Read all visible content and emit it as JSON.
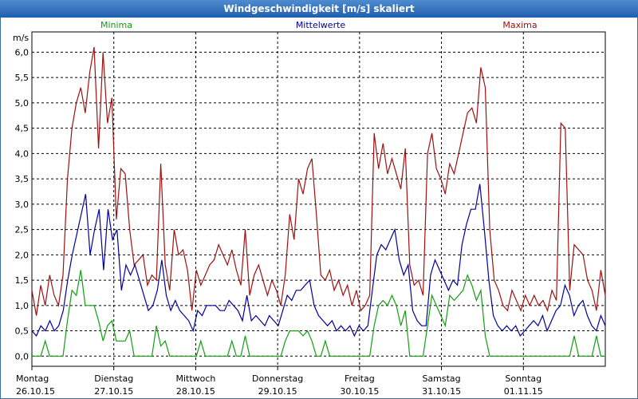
{
  "window": {
    "title": "Windgeschwindigkeit [m/s] skaliert"
  },
  "chart_data": {
    "type": "line",
    "title": "Windgeschwindigkeit [m/s] skaliert",
    "ylabel": "m/s",
    "ylim": [
      -0.2,
      6.4
    ],
    "y_ticks": [
      "0,0",
      "0,5",
      "1,0",
      "1,5",
      "2,0",
      "2,5",
      "3,0",
      "3,5",
      "4,0",
      "4,5",
      "5,0",
      "5,5",
      "6,0"
    ],
    "x_ticks": [
      {
        "day": "Montag",
        "date": "26.10.15"
      },
      {
        "day": "Dienstag",
        "date": "27.10.15"
      },
      {
        "day": "Mittwoch",
        "date": "28.10.15"
      },
      {
        "day": "Donnerstag",
        "date": "29.10.15"
      },
      {
        "day": "Freitag",
        "date": "30.10.15"
      },
      {
        "day": "Samstag",
        "date": "31.10.15"
      },
      {
        "day": "Sonntag",
        "date": "01.11.15"
      }
    ],
    "grid": true,
    "legend_position": "top",
    "series": [
      {
        "name": "Maxima",
        "color": "#a01010",
        "values": [
          1.3,
          0.8,
          1.4,
          1.0,
          1.6,
          1.2,
          1.0,
          1.6,
          3.5,
          4.5,
          5.0,
          5.3,
          4.8,
          5.6,
          6.1,
          4.1,
          6.0,
          4.6,
          5.1,
          2.7,
          3.7,
          3.6,
          2.5,
          1.8,
          1.9,
          2.0,
          1.4,
          1.6,
          1.5,
          3.8,
          1.8,
          1.3,
          2.5,
          2.0,
          2.1,
          1.7,
          0.9,
          1.7,
          1.4,
          1.6,
          1.8,
          1.9,
          2.2,
          2.0,
          1.8,
          2.1,
          1.7,
          1.4,
          2.5,
          1.2,
          1.6,
          1.8,
          1.5,
          1.2,
          1.5,
          1.3,
          1.0,
          1.6,
          2.8,
          2.3,
          3.5,
          3.2,
          3.7,
          3.9,
          2.8,
          1.6,
          1.5,
          1.7,
          1.3,
          1.5,
          1.2,
          1.4,
          1.0,
          1.3,
          0.9,
          1.0,
          1.2,
          4.4,
          3.7,
          4.2,
          3.6,
          3.9,
          3.6,
          3.3,
          4.1,
          1.8,
          1.4,
          1.5,
          1.2,
          4.0,
          4.4,
          3.7,
          3.5,
          3.2,
          3.8,
          3.6,
          4.0,
          4.4,
          4.8,
          4.9,
          4.6,
          5.7,
          5.3,
          2.5,
          1.5,
          1.3,
          1.0,
          0.9,
          1.3,
          1.1,
          0.9,
          1.2,
          1.0,
          1.2,
          1.0,
          1.1,
          0.9,
          1.3,
          1.1,
          4.6,
          4.5,
          1.3,
          2.2,
          2.1,
          2.0,
          1.5,
          1.3,
          0.9,
          1.7,
          1.2
        ]
      },
      {
        "name": "Mittelwerte",
        "color": "#0000a0",
        "values": [
          0.5,
          0.4,
          0.6,
          0.5,
          0.7,
          0.5,
          0.6,
          0.9,
          1.5,
          2.0,
          2.4,
          2.8,
          3.2,
          2.0,
          2.5,
          2.9,
          1.7,
          2.9,
          2.3,
          2.5,
          1.3,
          1.8,
          1.6,
          1.8,
          1.5,
          1.2,
          0.9,
          1.0,
          1.3,
          1.9,
          1.2,
          0.9,
          1.1,
          0.9,
          0.8,
          0.7,
          0.5,
          0.9,
          0.8,
          1.0,
          1.0,
          1.0,
          0.9,
          0.9,
          1.1,
          1.0,
          0.9,
          0.7,
          1.2,
          0.7,
          0.8,
          0.7,
          0.6,
          0.8,
          0.7,
          0.6,
          0.9,
          1.2,
          1.1,
          1.3,
          1.3,
          1.4,
          1.5,
          1.0,
          0.8,
          0.7,
          0.6,
          0.7,
          0.5,
          0.6,
          0.5,
          0.6,
          0.4,
          0.6,
          0.5,
          0.6,
          1.3,
          2.0,
          2.2,
          2.1,
          2.3,
          2.5,
          1.9,
          1.6,
          1.8,
          0.9,
          0.7,
          0.6,
          0.6,
          1.6,
          1.9,
          1.7,
          1.5,
          1.3,
          1.5,
          1.4,
          2.2,
          2.6,
          2.9,
          2.9,
          3.4,
          2.5,
          1.5,
          0.8,
          0.6,
          0.5,
          0.6,
          0.5,
          0.6,
          0.4,
          0.5,
          0.6,
          0.7,
          0.6,
          0.8,
          0.5,
          0.7,
          0.9,
          1.0,
          1.4,
          1.2,
          0.8,
          1.0,
          1.1,
          0.8,
          0.6,
          0.5,
          0.8,
          0.6
        ]
      },
      {
        "name": "Minima",
        "color": "#10a010",
        "values": [
          0.0,
          0.0,
          0.0,
          0.3,
          0.0,
          0.0,
          0.0,
          0.0,
          0.7,
          1.3,
          1.2,
          1.7,
          1.0,
          1.0,
          1.0,
          0.7,
          0.3,
          0.6,
          0.7,
          0.3,
          0.3,
          0.3,
          0.5,
          0.0,
          0.0,
          0.0,
          0.0,
          0.0,
          0.6,
          0.2,
          0.3,
          0.0,
          0.0,
          0.0,
          0.0,
          0.0,
          0.0,
          0.0,
          0.3,
          0.0,
          0.0,
          0.0,
          0.0,
          0.0,
          0.0,
          0.3,
          0.0,
          0.0,
          0.4,
          0.0,
          0.0,
          0.0,
          0.0,
          0.0,
          0.0,
          0.0,
          0.0,
          0.3,
          0.5,
          0.5,
          0.5,
          0.4,
          0.5,
          0.3,
          0.0,
          0.0,
          0.3,
          0.0,
          0.0,
          0.0,
          0.0,
          0.0,
          0.0,
          0.0,
          0.0,
          0.0,
          0.0,
          0.6,
          1.0,
          1.1,
          1.0,
          1.2,
          1.0,
          0.6,
          0.9,
          0.0,
          0.0,
          0.0,
          0.0,
          0.6,
          1.2,
          1.0,
          0.8,
          0.6,
          1.2,
          1.1,
          1.2,
          1.3,
          1.6,
          1.4,
          1.1,
          1.3,
          0.4,
          0.0,
          0.0,
          0.0,
          0.0,
          0.0,
          0.0,
          0.0,
          0.0,
          0.0,
          0.0,
          0.0,
          0.0,
          0.0,
          0.0,
          0.0,
          0.0,
          0.0,
          0.0,
          0.0,
          0.4,
          0.0,
          0.0,
          0.0,
          0.0,
          0.4,
          0.0,
          0.0
        ]
      }
    ]
  }
}
